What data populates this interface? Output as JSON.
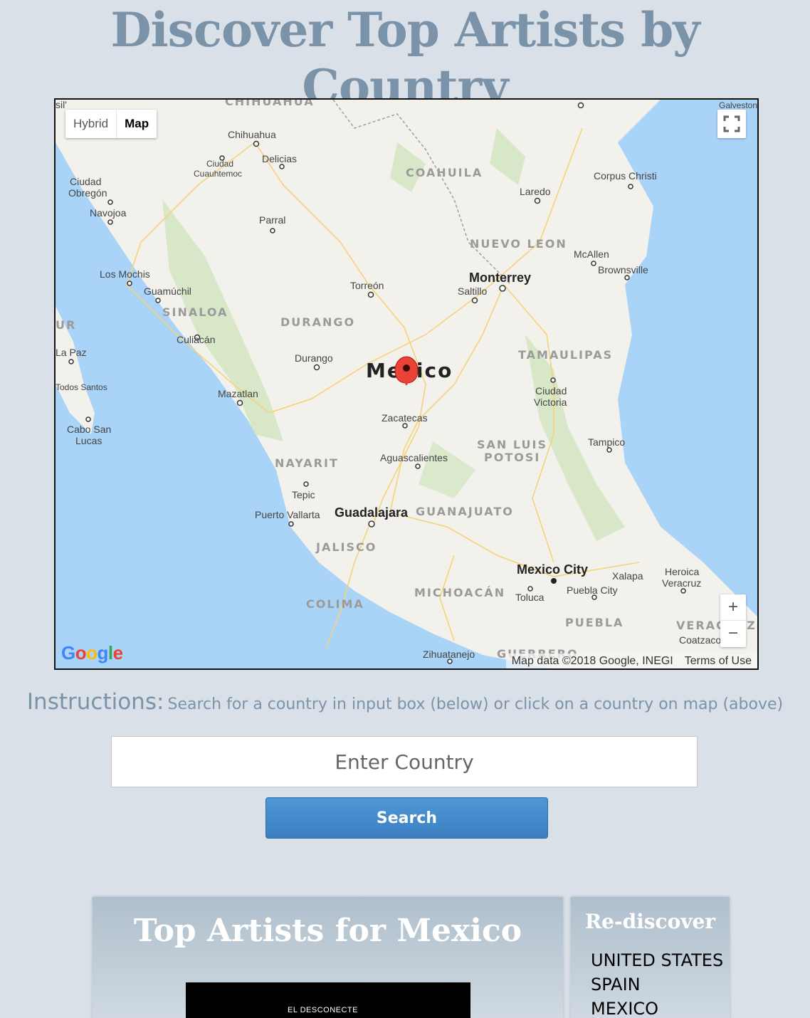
{
  "header": {
    "title": "Discover Top Artists by Country"
  },
  "map": {
    "type_controls": {
      "hybrid_label": "Hybrid",
      "map_label": "Map"
    },
    "zoom": {
      "in_label": "+",
      "out_label": "−"
    },
    "country_label": "Mexico",
    "logo_text": "Google",
    "attribution": {
      "data": "Map data ©2018 Google, INEGI",
      "terms": "Terms of Use"
    },
    "cities": [
      "Chihuahua",
      "Delicias",
      "Ciudad Cuauhtemoc",
      "Ciudad Obregón",
      "Navojoa",
      "Parral",
      "Laredo",
      "Corpus Christi",
      "Monterrey",
      "Saltillo",
      "McAllen",
      "Brownsville",
      "Los Mochis",
      "Guamúchil",
      "Torreón",
      "Culiacán",
      "La Paz",
      "Durango",
      "Mazatlan",
      "Todos Santos",
      "Ciudad Victoria",
      "Zacatecas",
      "Cabo San Lucas",
      "Tampico",
      "Aguascalientes",
      "Tepic",
      "Puerto Vallarta",
      "Guadalajara",
      "Mexico City",
      "Xalapa",
      "Heroica Veracruz",
      "Puebla City",
      "Toluca",
      "Zihuatanejo",
      "Coatzacoalcos",
      "Galveston"
    ],
    "states": [
      "CHIHUAHUA",
      "COAHUILA",
      "NUEVO LEON",
      "SINALOA",
      "DURANGO",
      "TAMAULIPAS",
      "SAN LUIS POTOSI",
      "NAYARIT",
      "GUANAJUATO",
      "JALISCO",
      "MICHOACÁN",
      "COLIMA",
      "PUEBLA",
      "GUERRERO",
      "VERACRUZ"
    ]
  },
  "instructions": {
    "label": "Instructions:",
    "text": "Search for a country in input box (below) or click on a country on map (above)"
  },
  "search": {
    "placeholder": "Enter Country",
    "button_label": "Search"
  },
  "results": {
    "title": "Top Artists for Mexico",
    "album_text": "EL DESCONECTE"
  },
  "rediscover": {
    "title": "Re-discover",
    "countries": [
      "UNITED STATES",
      "SPAIN",
      "MEXICO"
    ]
  }
}
